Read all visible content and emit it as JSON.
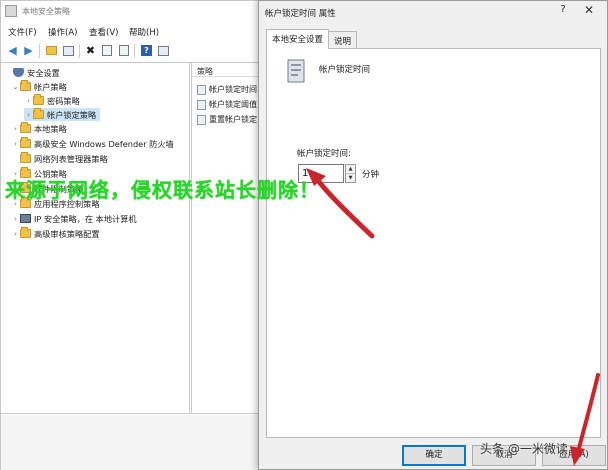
{
  "window": {
    "title": "本地安全策略"
  },
  "menubar": {
    "items": [
      "文件(F)",
      "操作(A)",
      "查看(V)",
      "帮助(H)"
    ]
  },
  "toolbar": {
    "icons": [
      "back-icon",
      "forward-icon",
      "up-folder-icon",
      "show-tree-icon",
      "delete-icon",
      "properties-icon",
      "export-icon",
      "help-icon",
      "view-icon"
    ]
  },
  "tree": {
    "items": [
      {
        "label": "安全设置",
        "icon": "shield-icon"
      },
      {
        "label": "帐户策略",
        "icon": "folder-icon"
      },
      {
        "label": "密码策略",
        "icon": "folder-icon"
      },
      {
        "label": "帐户锁定策略",
        "icon": "folder-icon",
        "selected": true
      },
      {
        "label": "本地策略",
        "icon": "folder-icon"
      },
      {
        "label": "高级安全 Windows Defender 防火墙",
        "icon": "folder-icon"
      },
      {
        "label": "网络列表管理器策略",
        "icon": "folder-icon"
      },
      {
        "label": "公钥策略",
        "icon": "folder-icon"
      },
      {
        "label": "软件限制策略",
        "icon": "folder-icon"
      },
      {
        "label": "应用程序控制策略",
        "icon": "folder-icon"
      },
      {
        "label": "IP 安全策略，在 本地计算机",
        "icon": "computer-icon"
      },
      {
        "label": "高级审核策略配置",
        "icon": "folder-icon"
      }
    ]
  },
  "list": {
    "header": "策略",
    "items": [
      "帐户锁定时间",
      "帐户锁定阈值",
      "重置帐户锁定"
    ]
  },
  "dialog": {
    "title": "帐户锁定时间 属性",
    "help": "?",
    "close": "✕",
    "tabs": [
      "本地安全设置",
      "说明"
    ],
    "policy_name": "帐户锁定时间",
    "field_label": "帐户锁定时间:",
    "field_value": "1",
    "unit": "分钟",
    "buttons": {
      "ok": "确定",
      "cancel": "取消",
      "apply": "应用(A)"
    }
  },
  "overlays": {
    "watermark": "来源于网络，侵权联系站长删除！",
    "credit": "头条 @一米微读"
  },
  "colors": {
    "selection": "#cce4f7",
    "watermark": "#27d727",
    "arrow": "#c8262b",
    "primary_border": "#0078d7"
  }
}
